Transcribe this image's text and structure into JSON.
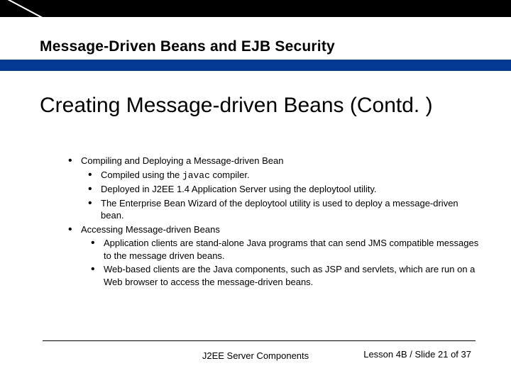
{
  "header": "Message-Driven Beans and EJB Security",
  "title": "Creating Message-driven Beans (Contd. )",
  "bullets": {
    "section1": {
      "heading": "Compiling and Deploying a Message-driven Bean",
      "items": {
        "a_pre": "Compiled using the ",
        "a_code": "javac",
        "a_post": " compiler.",
        "b": "Deployed in J2EE 1.4 Application Server using the deploytool utility.",
        "c": "The Enterprise Bean Wizard of the deploytool utility is used to deploy a message-driven bean."
      }
    },
    "section2": {
      "heading": "Accessing Message-driven Beans",
      "items": {
        "a": "Application clients are stand-alone Java programs that can send JMS compatible messages to the message driven beans.",
        "b": "Web-based clients are the Java components, such as JSP and servlets, which are run on a Web browser to access the message-driven beans."
      }
    }
  },
  "footer": {
    "center": "J2EE Server Components",
    "right": "Lesson 4B / Slide 21 of 37"
  }
}
